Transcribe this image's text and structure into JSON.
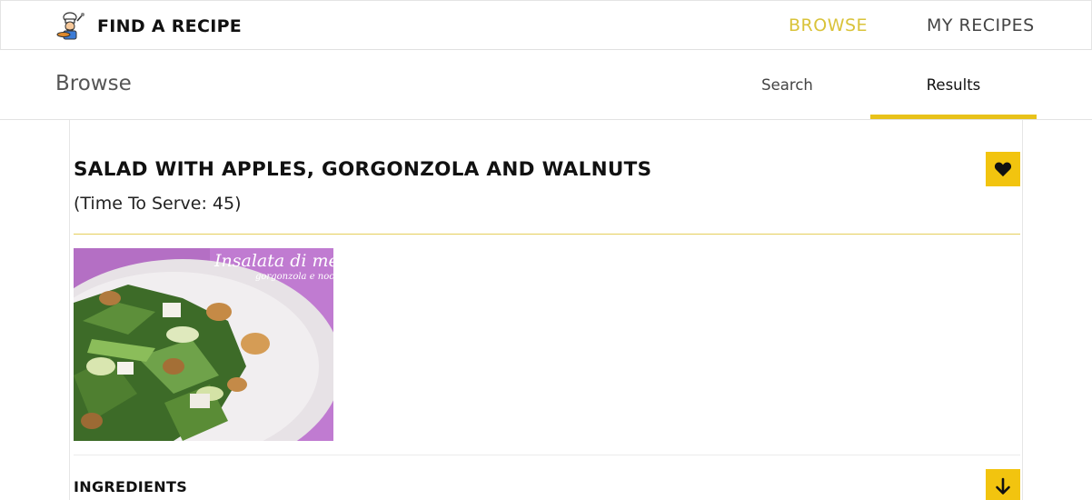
{
  "navbar": {
    "brand_name": "FIND A RECIPE",
    "logo_icon": "chef-icon",
    "links": [
      {
        "label": "BROWSE",
        "active": true
      },
      {
        "label": "MY RECIPES",
        "active": false
      }
    ]
  },
  "subheader": {
    "title": "Browse",
    "tabs": [
      {
        "label": "Search",
        "active": false
      },
      {
        "label": "Results",
        "active": true
      }
    ]
  },
  "recipe": {
    "title": "SALAD WITH APPLES, GORGONZOLA AND WALNUTS",
    "serve_time": "(Time To Serve: 45)",
    "favorite_icon": "heart-icon",
    "image_overlay_text": "Insalata di mel",
    "image_overlay_subtext": "gorgonzola e noci",
    "ingredients_label": "INGREDIENTS",
    "expand_icon": "arrow-down-icon"
  },
  "colors": {
    "accent": "#f2c40f",
    "active_link": "#d9c33a",
    "tab_underline": "#e8c21a"
  }
}
